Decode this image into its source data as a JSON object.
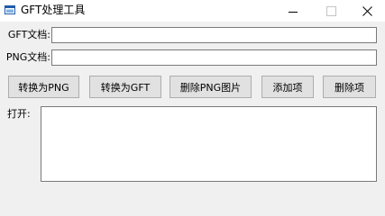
{
  "window": {
    "title": "GFT处理工具",
    "icons": {
      "app": "app-icon",
      "minimize": "minimize-icon",
      "maximize": "maximize-icon",
      "close": "close-icon"
    }
  },
  "form": {
    "gft_label": "GFT文档:",
    "gft_value": "",
    "png_label": "PNG文档:",
    "png_value": "",
    "open_label": "打开:",
    "open_value": ""
  },
  "buttons": {
    "to_png": "转换为PNG",
    "to_gft": "转换为GFT",
    "delete_png": "删除PNG图片",
    "add_item": "添加项",
    "delete_item": "删除项"
  },
  "colors": {
    "window_bg": "#f0f0f0",
    "titlebar_bg": "#ffffff",
    "button_bg": "#e1e1e1",
    "button_border": "#adadad",
    "field_border": "#7a7a7a"
  }
}
